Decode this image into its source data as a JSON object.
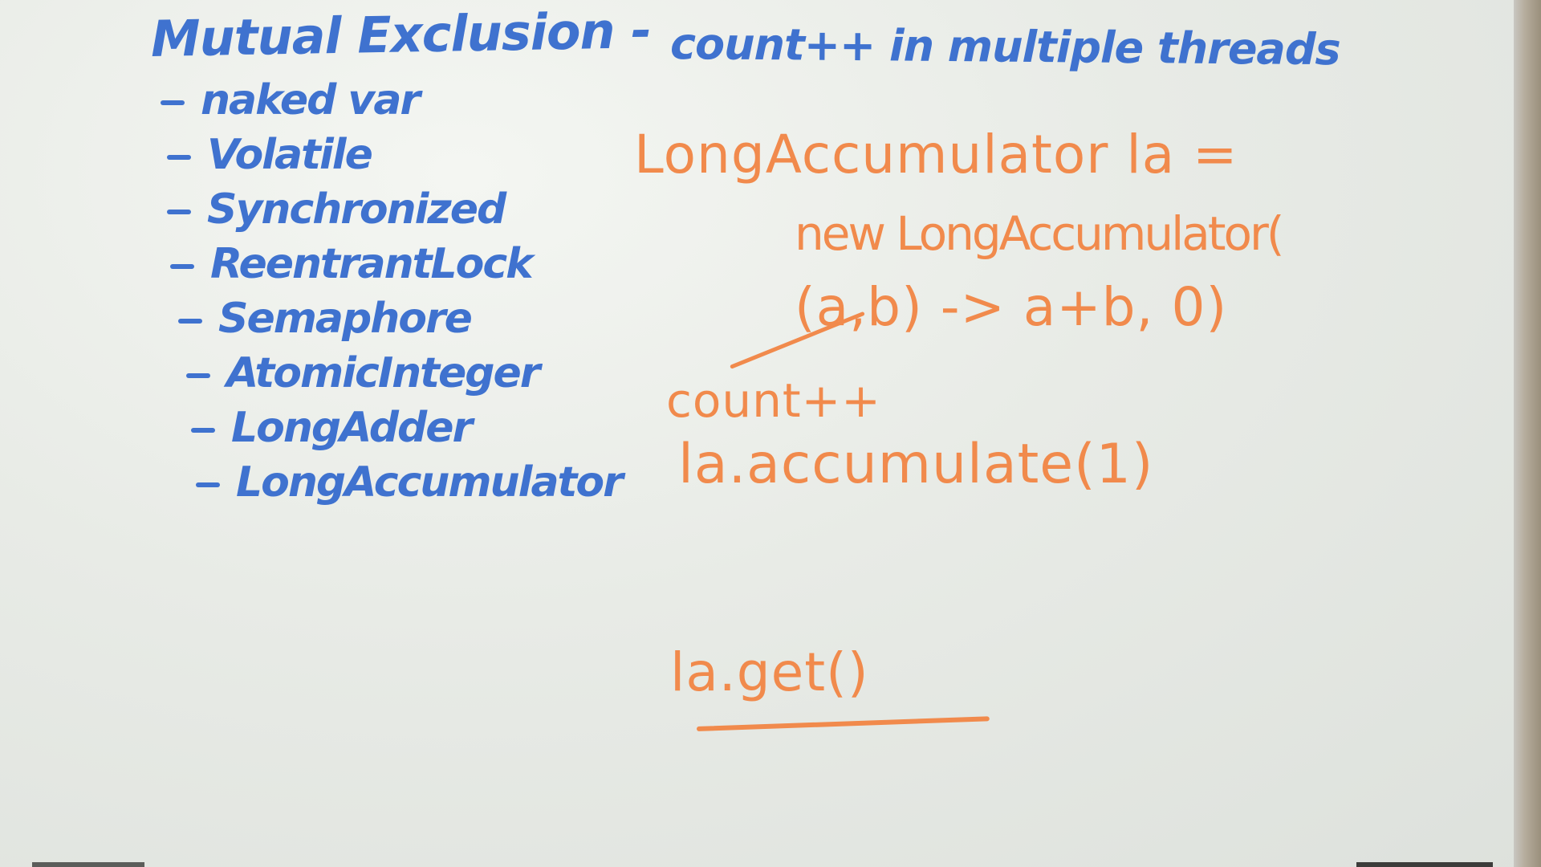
{
  "whiteboard": {
    "title": "Mutual Exclusion -",
    "subtitle": "count++ in multiple threads",
    "list_items": [
      "naked var",
      "Volatile",
      "Synchronized",
      "ReentrantLock",
      "Semaphore",
      "AtomicInteger",
      "LongAdder",
      "LongAccumulator"
    ],
    "code_lines": [
      "LongAccumulator la =",
      "new LongAccumulator(",
      "(a,b) -> a+b, 0)",
      "count++",
      "la.accumulate(1)",
      "la.get()"
    ],
    "colors": {
      "blue_marker": "#3f72cf",
      "orange_marker": "#f18a4c",
      "board": "#e8ebe6"
    }
  }
}
